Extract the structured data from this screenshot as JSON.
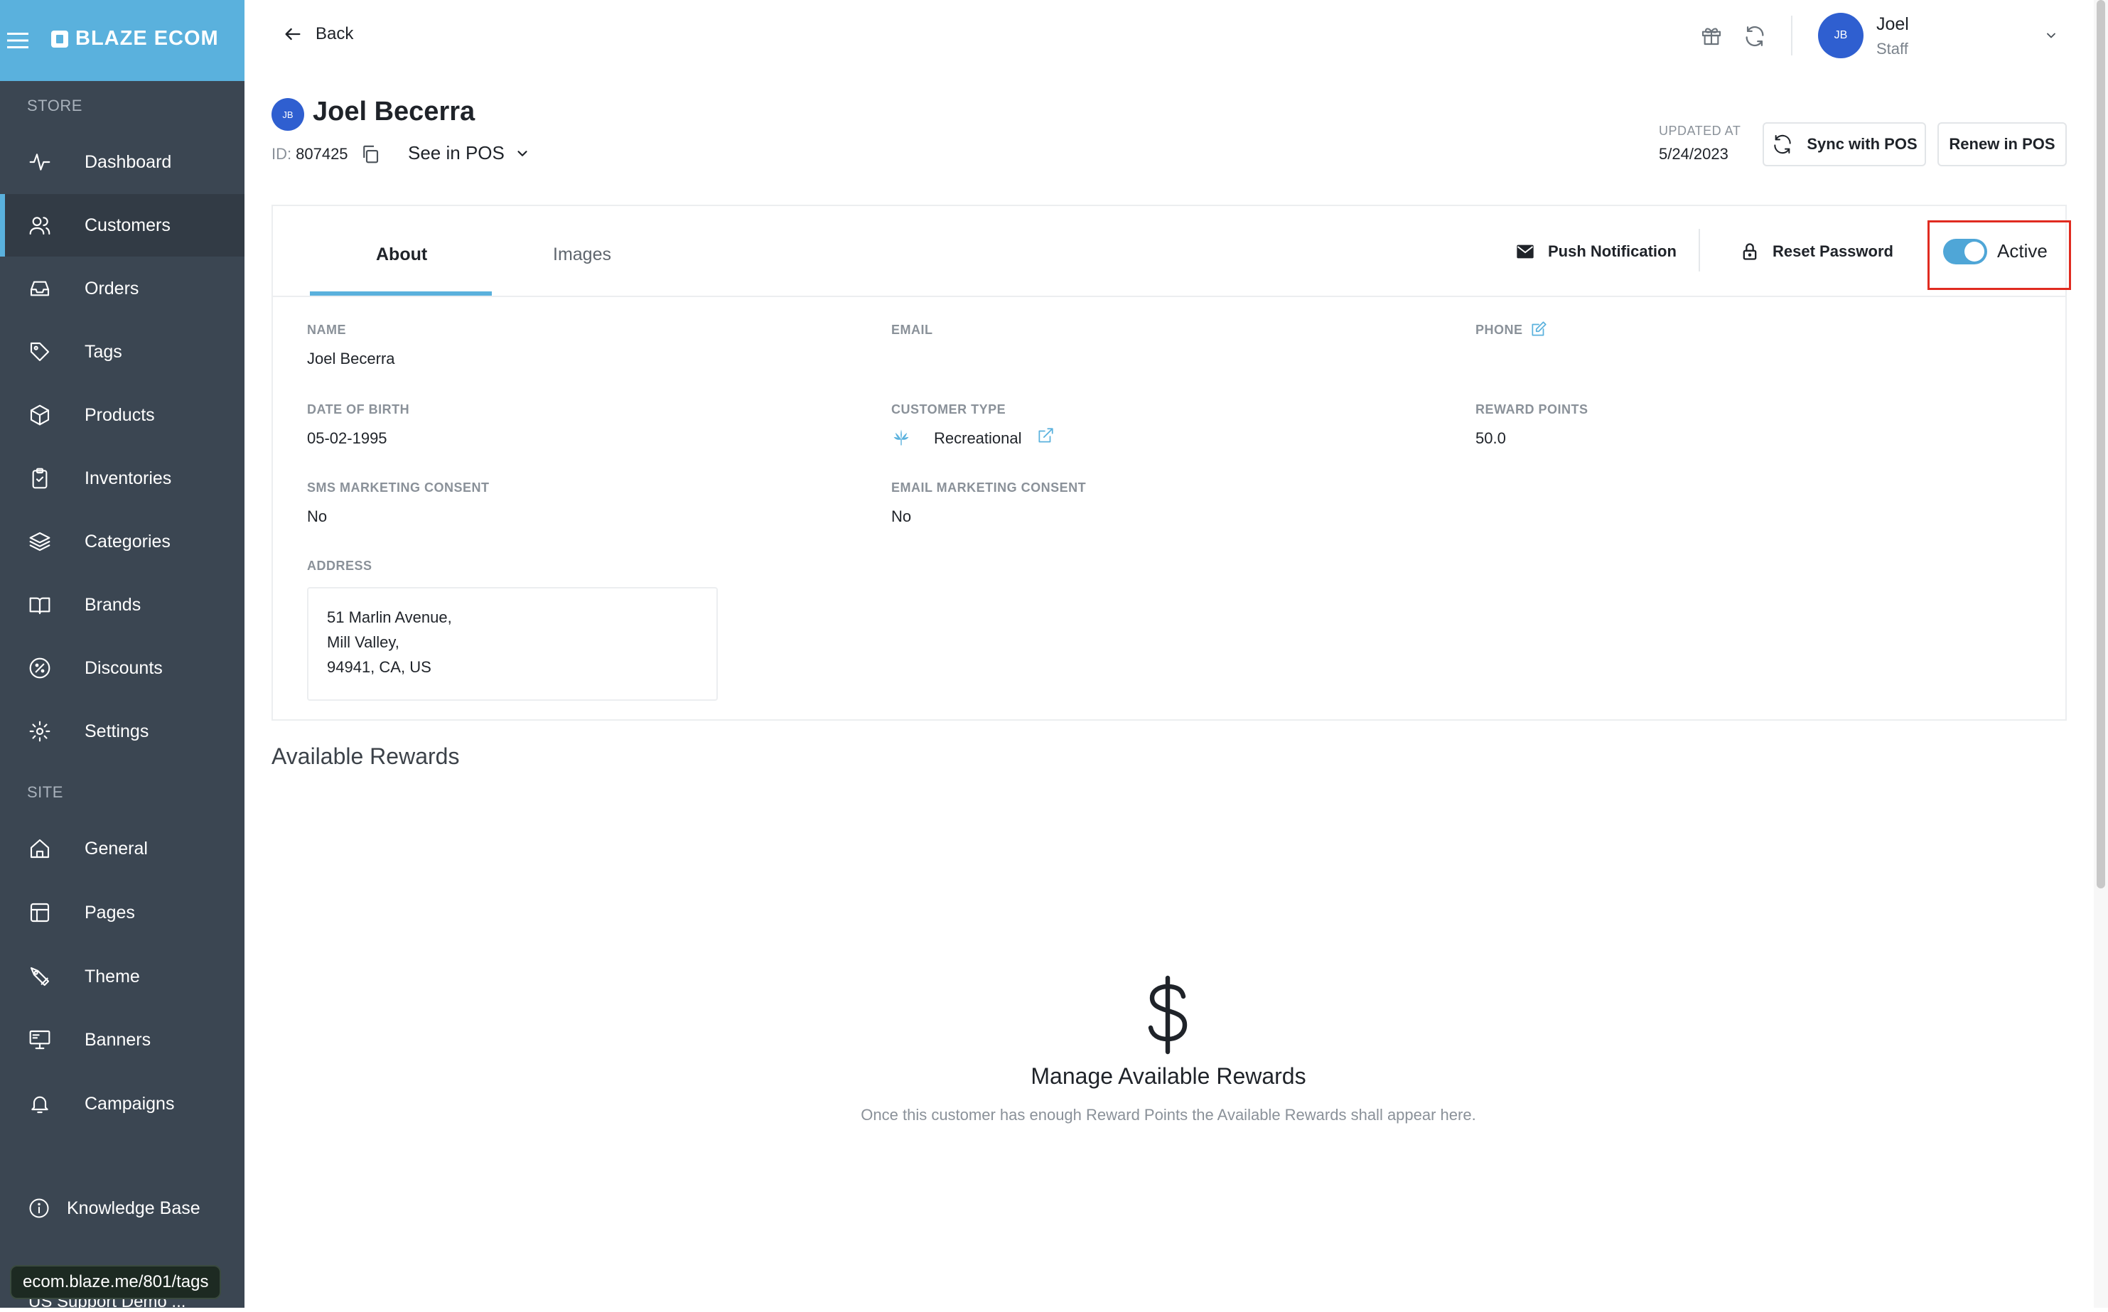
{
  "sidebar": {
    "brand": "BLAZE ECOM",
    "store_section": "STORE",
    "site_section": "SITE",
    "store_items": [
      {
        "label": "Dashboard",
        "icon": "activity-icon"
      },
      {
        "label": "Customers",
        "icon": "users-icon",
        "active": true
      },
      {
        "label": "Orders",
        "icon": "inbox-icon"
      },
      {
        "label": "Tags",
        "icon": "tag-icon"
      },
      {
        "label": "Products",
        "icon": "box-icon"
      },
      {
        "label": "Inventories",
        "icon": "clipboard-icon"
      },
      {
        "label": "Categories",
        "icon": "layers-icon"
      },
      {
        "label": "Brands",
        "icon": "book-icon"
      },
      {
        "label": "Discounts",
        "icon": "percent-icon"
      },
      {
        "label": "Settings",
        "icon": "gear-icon"
      }
    ],
    "site_items": [
      {
        "label": "General",
        "icon": "home-icon"
      },
      {
        "label": "Pages",
        "icon": "layout-icon"
      },
      {
        "label": "Theme",
        "icon": "brush-icon"
      },
      {
        "label": "Banners",
        "icon": "monitor-icon"
      },
      {
        "label": "Campaigns",
        "icon": "bell-icon"
      }
    ],
    "knowledge_base": "Knowledge Base",
    "url_tooltip": "ecom.blaze.me/801/tags",
    "store_switch": "US Support Demo ..."
  },
  "header": {
    "back_label": "Back",
    "user_initials": "JB",
    "user_name": "Joel",
    "user_role": "Staff"
  },
  "customer": {
    "initials": "JB",
    "name": "Joel Becerra",
    "id_prefix": "ID:",
    "id_value": "807425",
    "see_in_pos": "See in POS",
    "updated_at_label": "UPDATED AT",
    "updated_at_value": "5/24/2023",
    "sync_button": "Sync with POS",
    "renew_button": "Renew in POS"
  },
  "tabs": {
    "about": "About",
    "images": "Images"
  },
  "actions": {
    "push_notification": "Push Notification",
    "reset_password": "Reset Password",
    "active_label": "Active",
    "active_on": true
  },
  "fields": {
    "name_label": "NAME",
    "name_value": "Joel Becerra",
    "email_label": "EMAIL",
    "email_value": "",
    "phone_label": "PHONE",
    "dob_label": "DATE OF BIRTH",
    "dob_value": "05-02-1995",
    "customer_type_label": "CUSTOMER TYPE",
    "customer_type_value": "Recreational",
    "reward_points_label": "REWARD POINTS",
    "reward_points_value": "50.0",
    "sms_consent_label": "SMS MARKETING CONSENT",
    "sms_consent_value": "No",
    "email_consent_label": "EMAIL MARKETING CONSENT",
    "email_consent_value": "No",
    "address_label": "ADDRESS",
    "address_lines": [
      "51 Marlin Avenue,",
      "Mill Valley,",
      "94941, CA, US"
    ]
  },
  "rewards": {
    "title": "Available Rewards",
    "empty_title": "Manage Available Rewards",
    "empty_subtitle": "Once this customer has enough Reward Points the Available Rewards shall appear here."
  },
  "colors": {
    "sidebar_bg": "#3b4652",
    "brand_blue": "#5ab1dd",
    "avatar_blue": "#2f5fd0",
    "highlight_red": "#e02b20"
  }
}
